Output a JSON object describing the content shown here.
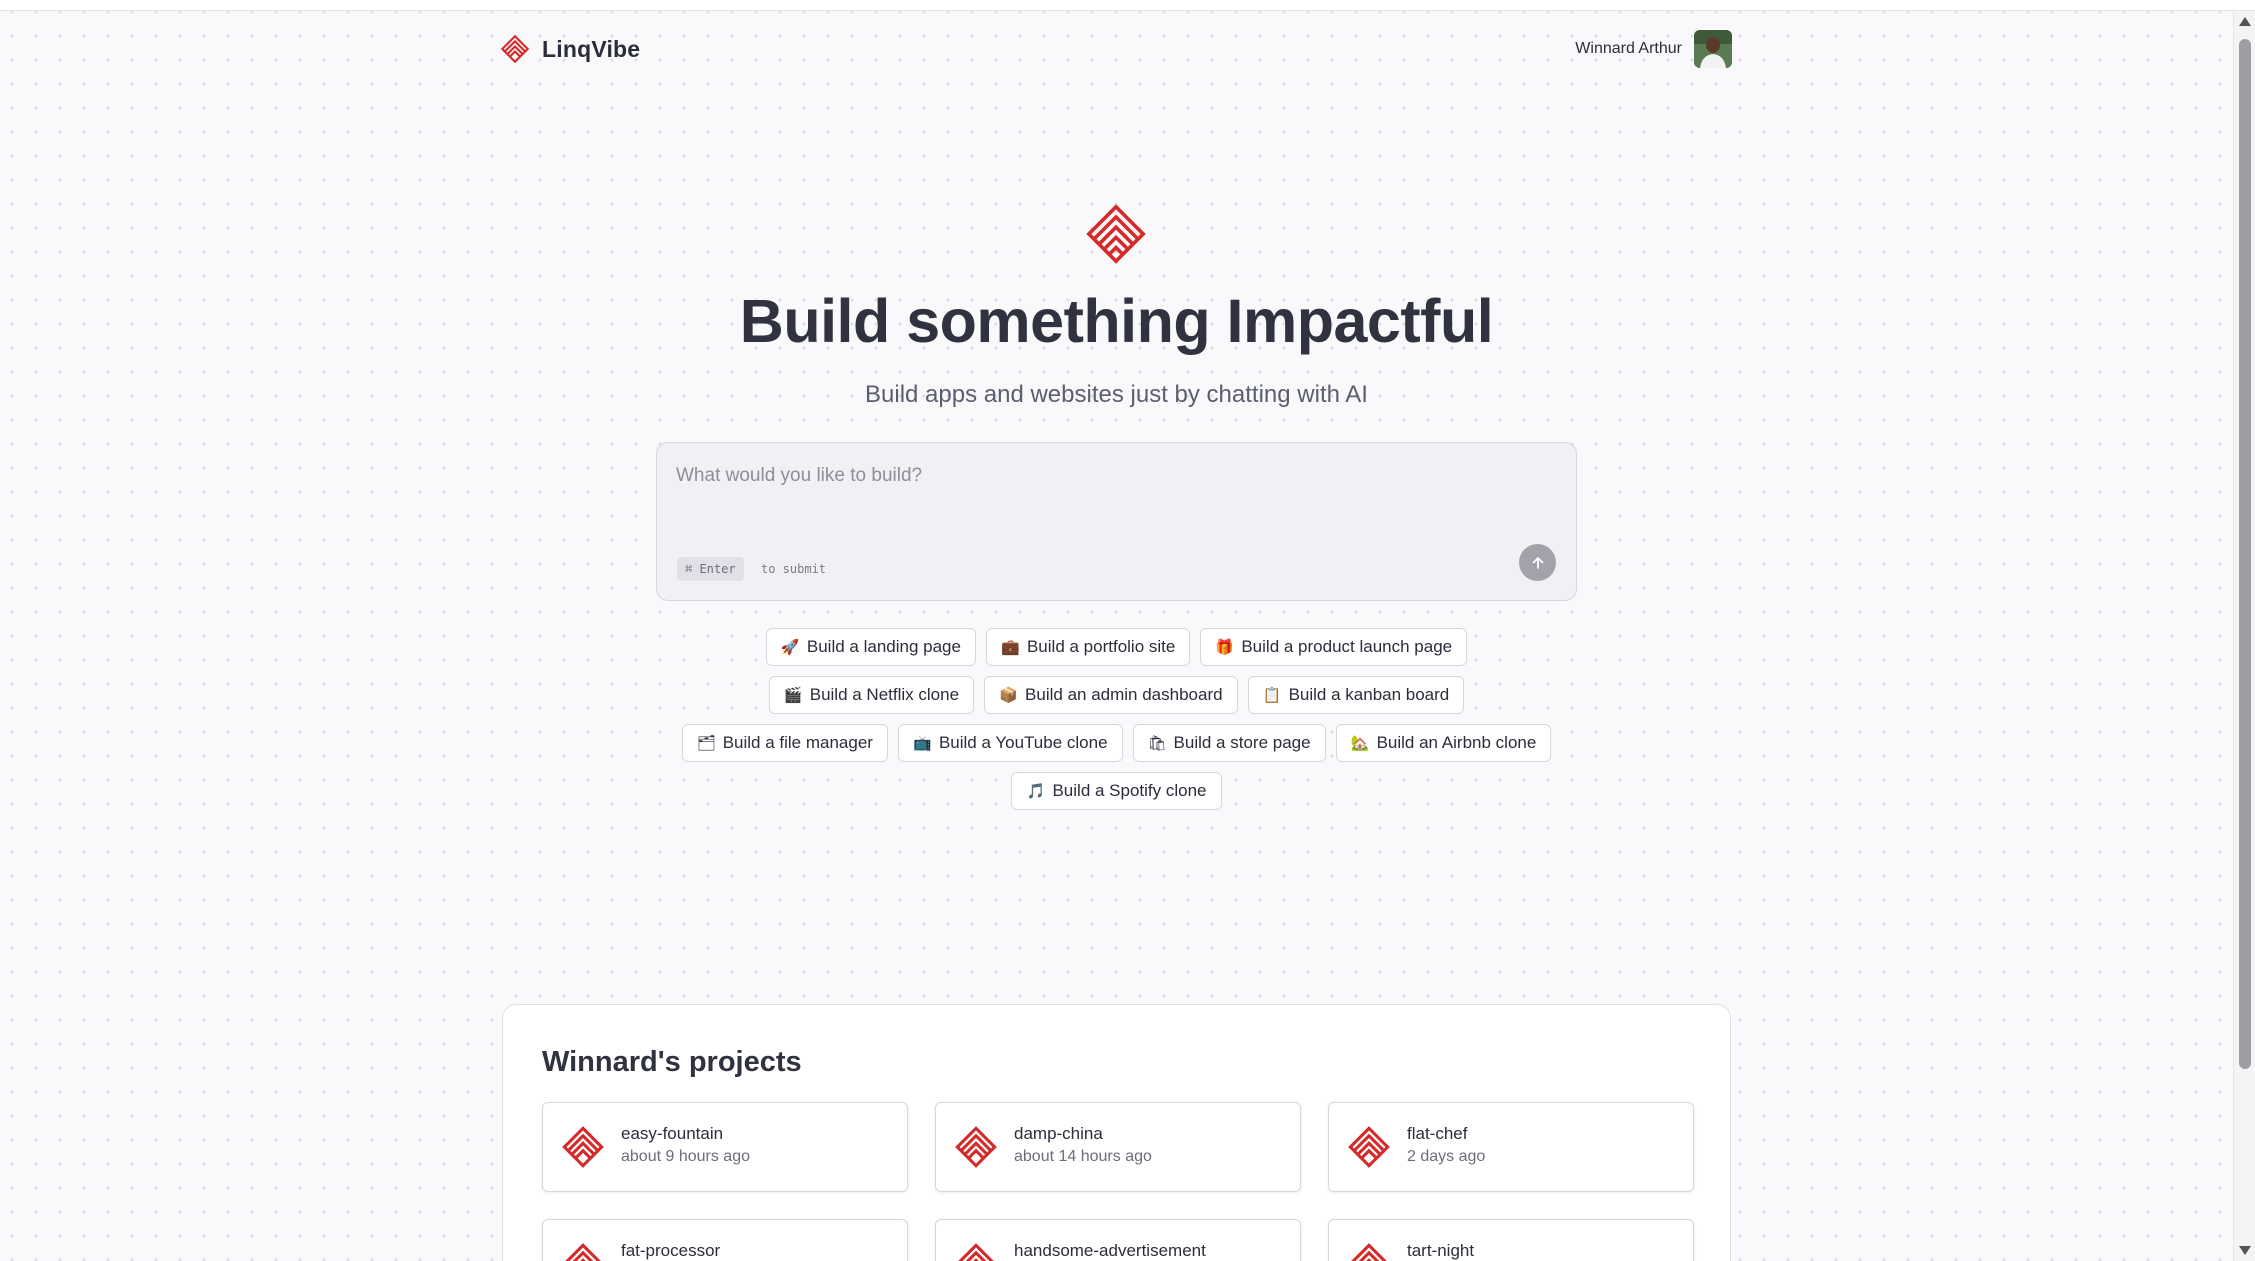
{
  "brand": {
    "name": "LinqVibe",
    "accent": "#d42a2a"
  },
  "user": {
    "name": "Winnard Arthur"
  },
  "hero": {
    "title": "Build something Impactful",
    "subtitle": "Build apps and websites just by chatting with AI"
  },
  "prompt": {
    "placeholder": "What would you like to build?",
    "shortcut_key": "⌘ Enter",
    "shortcut_hint": "to submit"
  },
  "suggestions": [
    [
      {
        "emoji": "🚀",
        "label": "Build a landing page"
      },
      {
        "emoji": "💼",
        "label": "Build a portfolio site"
      },
      {
        "emoji": "🎁",
        "label": "Build a product launch page"
      }
    ],
    [
      {
        "emoji": "🎬",
        "label": "Build a Netflix clone"
      },
      {
        "emoji": "📦",
        "label": "Build an admin dashboard"
      },
      {
        "emoji": "📋",
        "label": "Build a kanban board"
      }
    ],
    [
      {
        "emoji": "🗂",
        "label": "Build a file manager"
      },
      {
        "emoji": "📺",
        "label": "Build a YouTube clone"
      },
      {
        "emoji": "🛍",
        "label": "Build a store page"
      },
      {
        "emoji": "🏡",
        "label": "Build an Airbnb clone"
      }
    ],
    [
      {
        "emoji": "🎵",
        "label": "Build a Spotify clone"
      }
    ]
  ],
  "projects": {
    "title": "Winnard's projects",
    "items": [
      {
        "name": "easy-fountain",
        "time": "about 9 hours ago"
      },
      {
        "name": "damp-china",
        "time": "about 14 hours ago"
      },
      {
        "name": "flat-chef",
        "time": "2 days ago"
      },
      {
        "name": "fat-processor",
        "time": ""
      },
      {
        "name": "handsome-advertisement",
        "time": ""
      },
      {
        "name": "tart-night",
        "time": ""
      }
    ]
  }
}
